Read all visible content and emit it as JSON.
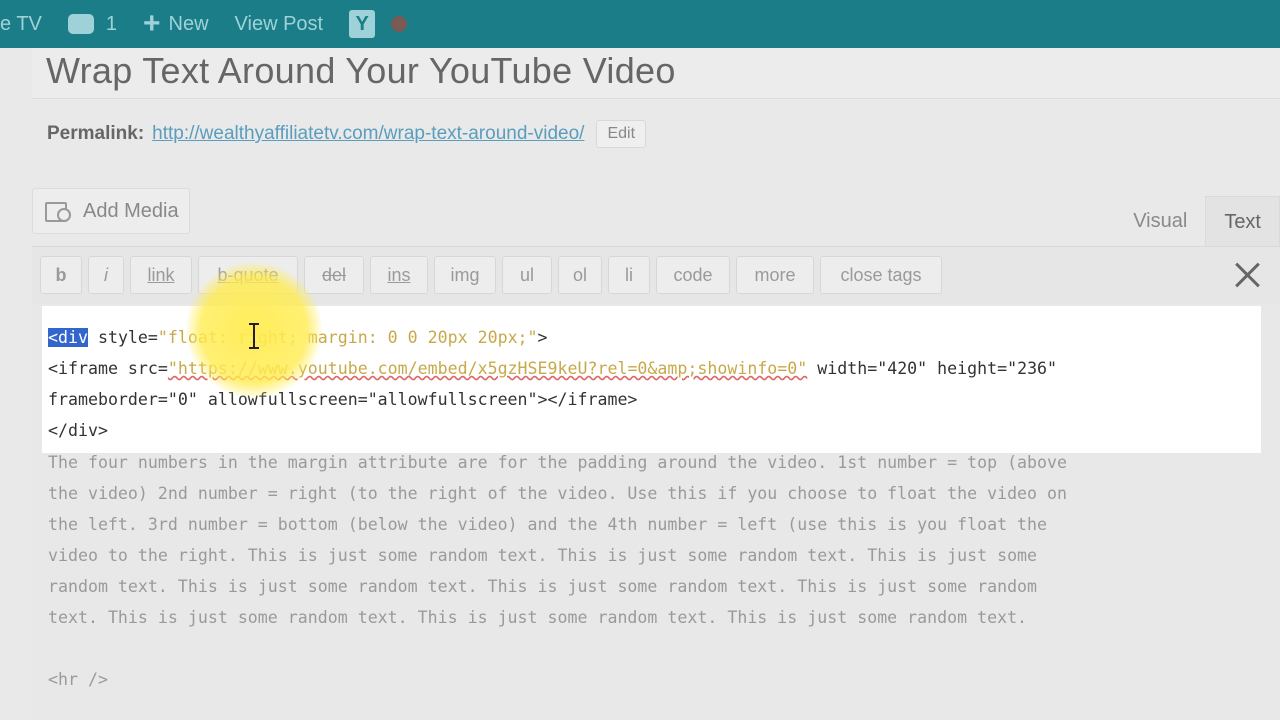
{
  "admin_bar": {
    "site_label": "e TV",
    "comments_count": "1",
    "new_label": "New",
    "view_post_label": "View Post",
    "yoast_label": "Y",
    "icons": [
      "comment-bubble-icon",
      "plus-icon",
      "yoast-icon",
      "notification-dot-icon"
    ]
  },
  "post": {
    "title": "Wrap Text Around Your YouTube Video",
    "permalink_label": "Permalink:",
    "permalink_url": "http://wealthyaffiliatetv.com/wrap-text-around-video/",
    "edit_label": "Edit"
  },
  "media": {
    "add_media_label": "Add Media"
  },
  "editor_tabs": {
    "visual": "Visual",
    "text": "Text",
    "active": "text"
  },
  "quicktags": [
    "b",
    "i",
    "link",
    "b-quote",
    "del",
    "ins",
    "img",
    "ul",
    "ol",
    "li",
    "code",
    "more",
    "close tags"
  ],
  "code_block": {
    "line1_tag": "<div",
    "line1_attr": " style=",
    "line1_value": "\"float: right; margin: 0 0 20px 20px;\"",
    "line1_end": ">",
    "line2_start": "<iframe src=",
    "line2_url": "\"https://www.youtube.com/embed/x5gzHSE9keU?rel=0&amp;showinfo=0\"",
    "line2_end": " width=\"420\" height=\"236\"",
    "line3": "frameborder=\"0\" allowfullscreen=\"allowfullscreen\"></iframe>",
    "line4": "</div>"
  },
  "body_lines": [
    "The four numbers in the margin attribute are for the padding around the video. 1st number = top (above",
    "the video) 2nd number = right (to the right of the video. Use this if you choose to float the video on",
    "the left. 3rd number = bottom (below the video) and the 4th number = left (use this is you float the",
    "video to the right. This is just some random text. This is just some random text. This is just some",
    "random text. This is just some random text. This is just some random text. This is just some random",
    "text. This is just some random text. This is just some random text. This is just some random text."
  ],
  "hr_line": "<hr />"
}
